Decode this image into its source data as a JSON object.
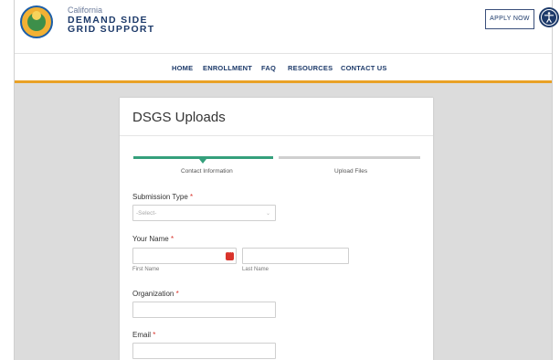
{
  "brand": {
    "small": "California",
    "line1": "DEMAND SIDE",
    "line2": "GRID SUPPORT",
    "logo_icon": "california-seal-icon"
  },
  "header": {
    "apply_label": "APPLY NOW",
    "accessibility_icon": "accessibility-icon"
  },
  "nav": {
    "items": [
      {
        "label": "HOME"
      },
      {
        "label": "ENROLLMENT"
      },
      {
        "label": "FAQ"
      },
      {
        "label": "RESOURCES"
      },
      {
        "label": "CONTACT US"
      }
    ]
  },
  "colors": {
    "brand_navy": "#1d3a6a",
    "accent_orange": "#e9a126",
    "step_green": "#35a07c",
    "required_red": "#d9332b"
  },
  "form": {
    "title": "DSGS Uploads",
    "steps": [
      {
        "label": "Contact Information",
        "active": true
      },
      {
        "label": "Upload Files",
        "active": false
      }
    ],
    "submission_type": {
      "label": "Submission Type",
      "required_mark": "*",
      "placeholder": "-Select-"
    },
    "your_name": {
      "label": "Your Name",
      "required_mark": "*",
      "first_label": "First Name",
      "last_label": "Last Name"
    },
    "organization": {
      "label": "Organization",
      "required_mark": "*"
    },
    "email": {
      "label": "Email",
      "required_mark": "*"
    }
  }
}
